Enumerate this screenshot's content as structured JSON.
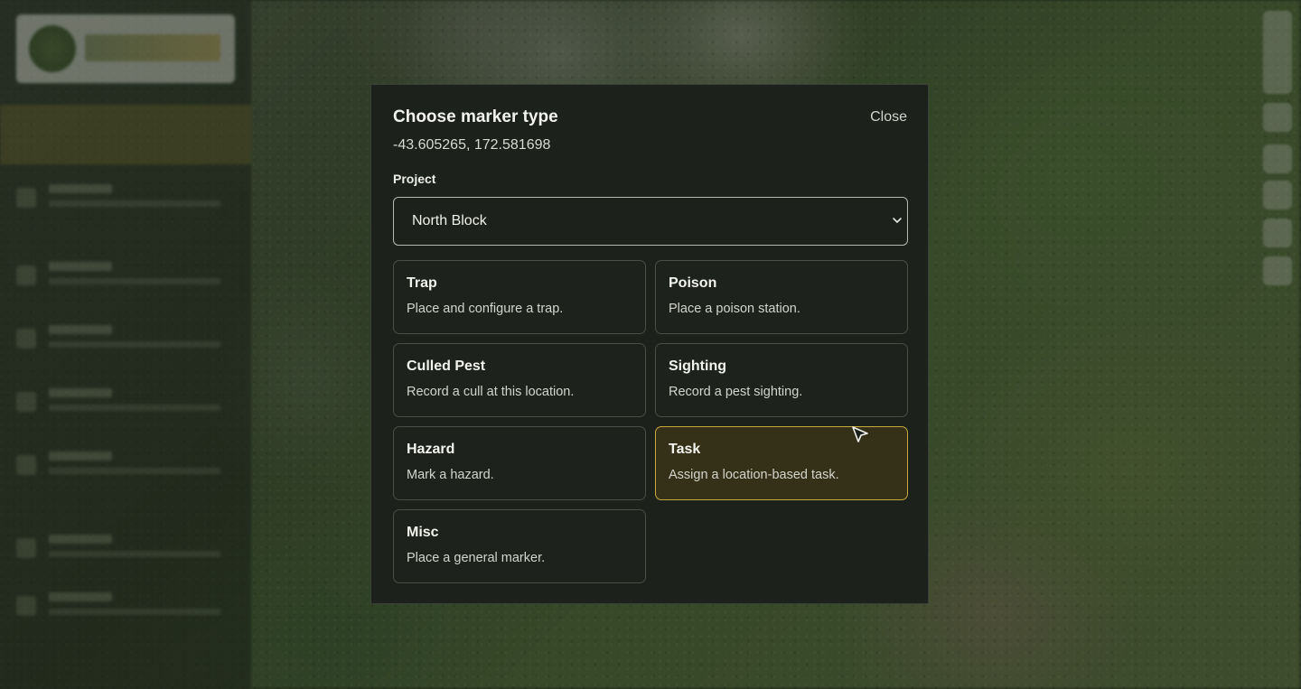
{
  "modal": {
    "title": "Choose marker type",
    "close_label": "Close",
    "coordinates": "-43.605265, 172.581698",
    "project_label": "Project",
    "project_selected": "North Block",
    "marker_types": [
      {
        "title": "Trap",
        "description": "Place and configure a trap."
      },
      {
        "title": "Poison",
        "description": "Place a poison station."
      },
      {
        "title": "Culled Pest",
        "description": "Record a cull at this location."
      },
      {
        "title": "Sighting",
        "description": "Record a pest sighting."
      },
      {
        "title": "Hazard",
        "description": "Mark a hazard."
      },
      {
        "title": "Task",
        "description": "Assign a location-based task.",
        "selected": true
      },
      {
        "title": "Misc",
        "description": "Place a general marker."
      }
    ]
  },
  "colors": {
    "accent": "#c9a93b",
    "modal_bg": "#1c211c",
    "selected_card_bg": "#353119"
  },
  "icons": {
    "select_chevron": "chevron-down-icon",
    "pointer": "cursor-icon"
  }
}
